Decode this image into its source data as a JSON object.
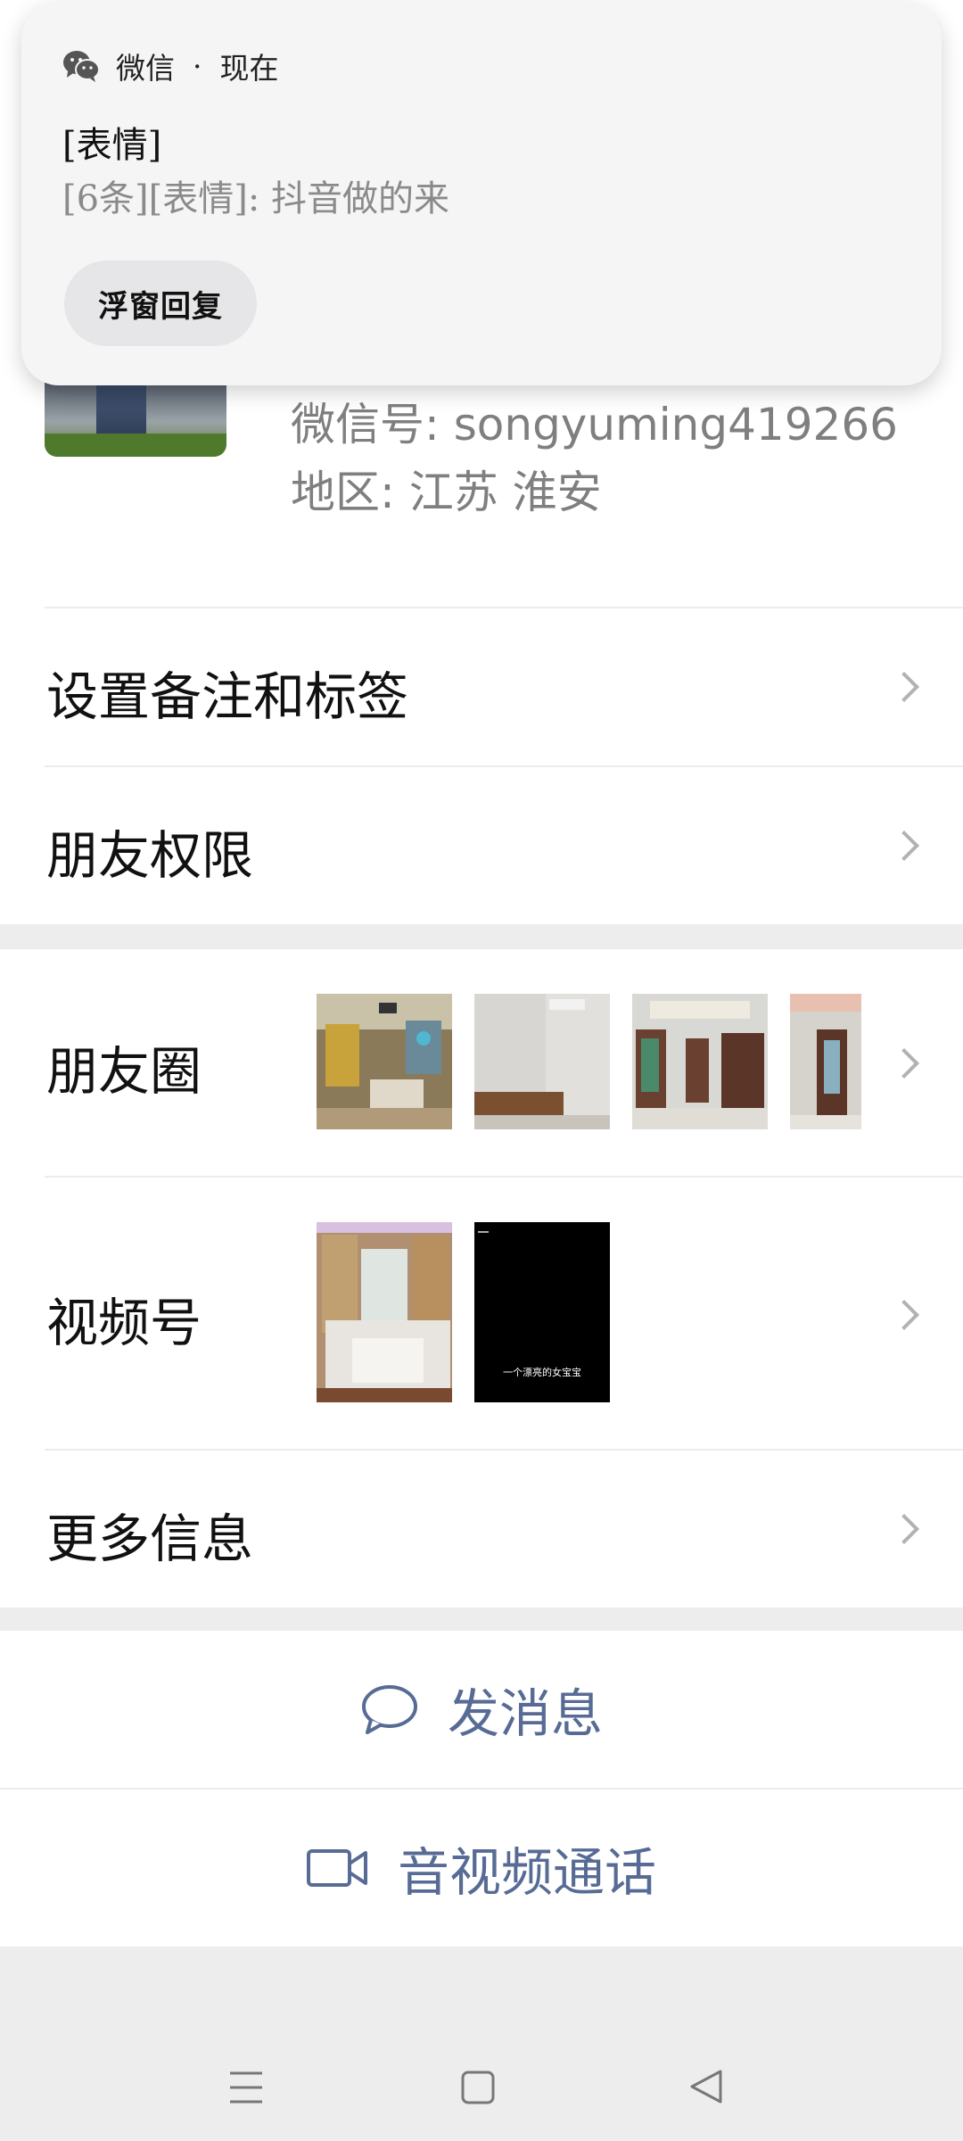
{
  "notification": {
    "app": "微信",
    "separator": "·",
    "time": "现在",
    "title": "[表情]",
    "body": "[6条][表情]: 抖音做的来",
    "reply_button": "浮窗回复"
  },
  "profile": {
    "wechat_id": "微信号:  songyuming419266",
    "region": "地区:  江苏  淮安"
  },
  "rows": {
    "remark_tags": "设置备注和标签",
    "permissions": "朋友权限",
    "moments": "朋友圈",
    "channels": "视频号",
    "more_info": "更多信息"
  },
  "channels": {
    "video_caption": "一个漂亮的女宝宝"
  },
  "actions": {
    "message": "发消息",
    "call": "音视频通话"
  },
  "colors": {
    "link_blue": "#576b95",
    "divider": "#ececec",
    "background": "#ededed"
  }
}
